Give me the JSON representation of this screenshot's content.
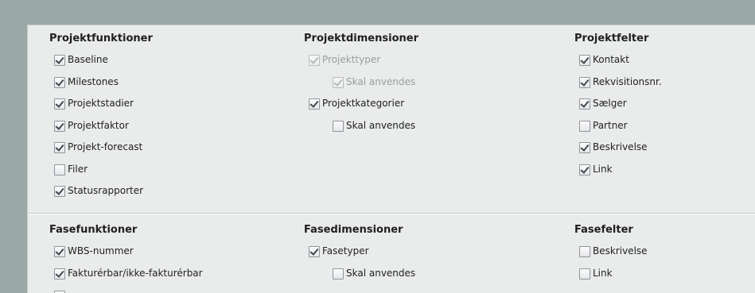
{
  "sections": [
    {
      "columns": [
        {
          "heading": "Projektfunktioner",
          "items": [
            {
              "label": "Baseline",
              "checked": true
            },
            {
              "label": "Milestones",
              "checked": true
            },
            {
              "label": "Projektstadier",
              "checked": true
            },
            {
              "label": "Projektfaktor",
              "checked": true
            },
            {
              "label": "Projekt-forecast",
              "checked": true
            },
            {
              "label": "Filer",
              "checked": false
            },
            {
              "label": "Statusrapporter",
              "checked": true
            }
          ]
        },
        {
          "heading": "Projektdimensioner",
          "items": [
            {
              "label": "Projekttyper",
              "checked": true,
              "disabled": true,
              "indent": 0
            },
            {
              "label": "Skal anvendes",
              "checked": true,
              "disabled": true,
              "indent": 1
            },
            {
              "label": "Projektkategorier",
              "checked": true,
              "indent": 0
            },
            {
              "label": "Skal anvendes",
              "checked": false,
              "indent": 1
            }
          ]
        },
        {
          "heading": "Projektfelter",
          "items": [
            {
              "label": "Kontakt",
              "checked": true
            },
            {
              "label": "Rekvisitionsnr.",
              "checked": true
            },
            {
              "label": "Sælger",
              "checked": true
            },
            {
              "label": "Partner",
              "checked": false
            },
            {
              "label": "Beskrivelse",
              "checked": true
            },
            {
              "label": "Link",
              "checked": true
            }
          ]
        }
      ]
    },
    {
      "columns": [
        {
          "heading": "Fasefunktioner",
          "items": [
            {
              "label": "WBS-nummer",
              "checked": true
            },
            {
              "label": "Fakturérbar/ikke-fakturérbar",
              "checked": true
            },
            {
              "label": "",
              "checked": false
            }
          ]
        },
        {
          "heading": "Fasedimensioner",
          "items": [
            {
              "label": "Fasetyper",
              "checked": true,
              "indent": 0
            },
            {
              "label": "Skal anvendes",
              "checked": false,
              "indent": 1
            }
          ]
        },
        {
          "heading": "Fasefelter",
          "items": [
            {
              "label": "Beskrivelse",
              "checked": false
            },
            {
              "label": "Link",
              "checked": false
            }
          ]
        }
      ]
    }
  ]
}
